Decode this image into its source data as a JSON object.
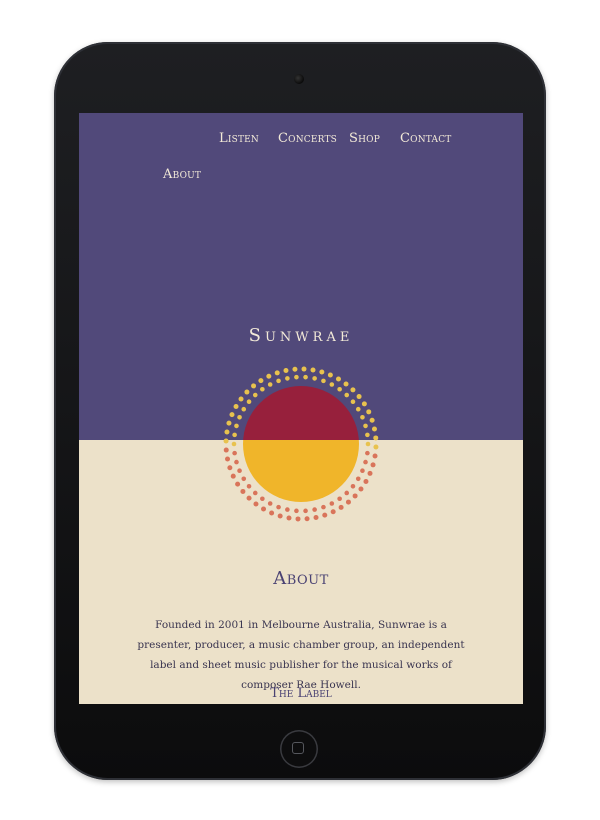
{
  "nav": {
    "listen": "Listen",
    "concerts": "Concerts",
    "shop": "Shop",
    "contact": "Contact",
    "about": "About"
  },
  "site": {
    "title": "Sunwrae"
  },
  "about": {
    "heading": "About",
    "text": "Founded in 2001 in Melbourne Australia, Sunwrae is a presenter, producer, a music chamber group, an independent label and sheet music publisher for the musical works of composer Rae Howell."
  },
  "label_section": {
    "heading": "The Label"
  },
  "colors": {
    "top_band": "#51497a",
    "bottom_band": "#ece1c9",
    "sun_red": "#97203c",
    "sun_yellow": "#f0b52a",
    "dots_yellow": "#e8c24e",
    "dots_coral": "#d9745a",
    "heading": "#4a4273"
  },
  "icons": {
    "logo": "sun-logo-icon",
    "camera": "camera-icon",
    "home": "home-button-icon"
  }
}
